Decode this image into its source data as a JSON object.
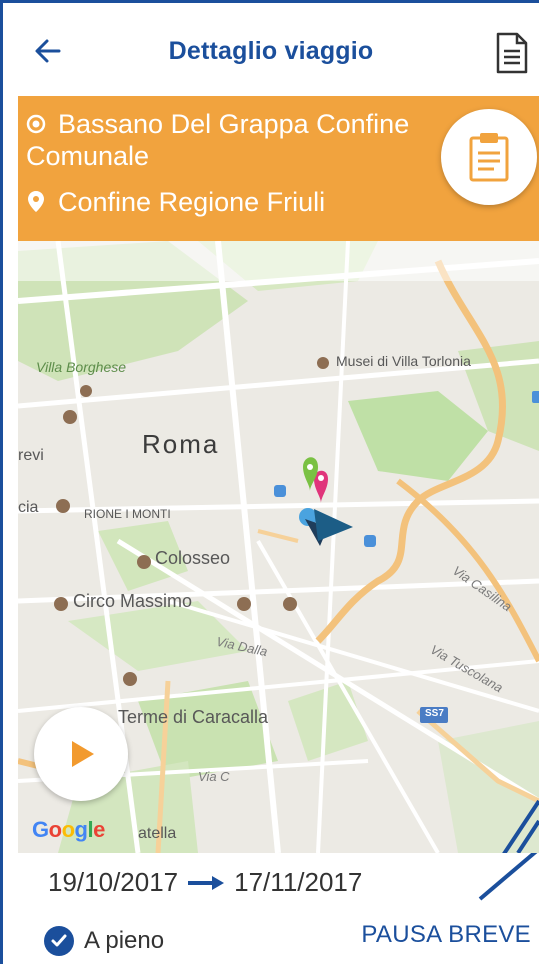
{
  "header": {
    "title": "Dettaglio viaggio",
    "back_icon": "arrow-left-icon",
    "document_icon": "document-icon"
  },
  "route": {
    "from_line1": "Bassano Del Grappa Confine",
    "from_line2": "Comunale",
    "to": "Confine Regione Friuli",
    "clipboard_icon": "clipboard-icon"
  },
  "map": {
    "city": "Roma",
    "labels": {
      "villa_borghese": "Villa Borghese",
      "musei_villa_torlonia": "Musei di Villa Torlonia",
      "trevi": "revi",
      "monti": "RIONE I MONTI",
      "colosseo": "Colosseo",
      "circo_massimo": "Circo Massimo",
      "via_dalla": "Via Dalla",
      "via_casilina": "Via Casilina",
      "via_tuscolana": "Via Tuscolana",
      "terme": "Terme di Caracalla",
      "via_c": "Via C",
      "cia": "cia",
      "atella": "atella",
      "highway": "SS7"
    },
    "google": "Google",
    "play_icon": "play-icon"
  },
  "footer": {
    "date_start": "19/10/2017",
    "date_end": "17/11/2017",
    "full_label": "A pieno",
    "pause_label": "PAUSA BREVE"
  },
  "colors": {
    "brand_blue": "#1b4f9c",
    "banner_orange": "#f1a33e",
    "play_orange": "#f29a2e"
  }
}
